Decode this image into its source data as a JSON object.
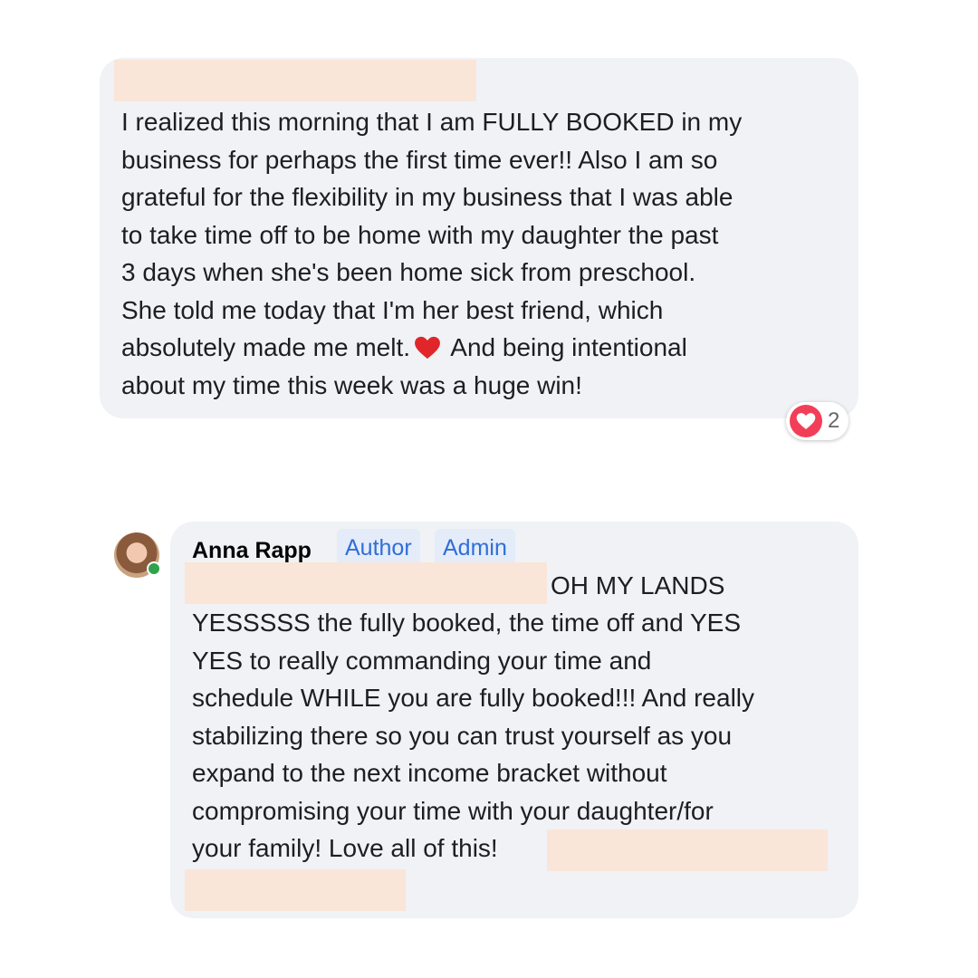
{
  "comment1": {
    "text": "I realized this morning that I am FULLY BOOKED in my\nbusiness for perhaps the first time ever!! Also I am so\ngrateful for the flexibility in my business that I was able\nto take time off to be home with my daughter the past\n3 days when she's been home sick from preschool.\nShe told me today that I'm her best friend, which\nabsolutely made me melt.",
    "text_after_heart": " And being intentional\nabout my time this week was a huge win!",
    "inline_icon": "red-heart-icon",
    "reaction": {
      "icon": "love-reaction-icon",
      "count": "2"
    }
  },
  "comment2": {
    "author": "Anna Rapp",
    "badges": [
      "Author",
      "Admin"
    ],
    "first_line": "OH MY LANDS",
    "text": "YESSSSS the fully booked, the time off and YES\nYES to really commanding your time and\nschedule WHILE you are fully booked!!! And really\nstabilizing there so you can trust yourself as you\nexpand to the next income bracket without\ncompromising your time with your daughter/for\nyour family! Love all of this!",
    "avatar_status": "online"
  },
  "colors": {
    "bubble": "#f0f2f5",
    "redaction": "#f9e6d8",
    "badge_bg": "#e4ecf9",
    "badge_text": "#2f6ed8",
    "love": "#f33e58",
    "online": "#31a24c"
  }
}
